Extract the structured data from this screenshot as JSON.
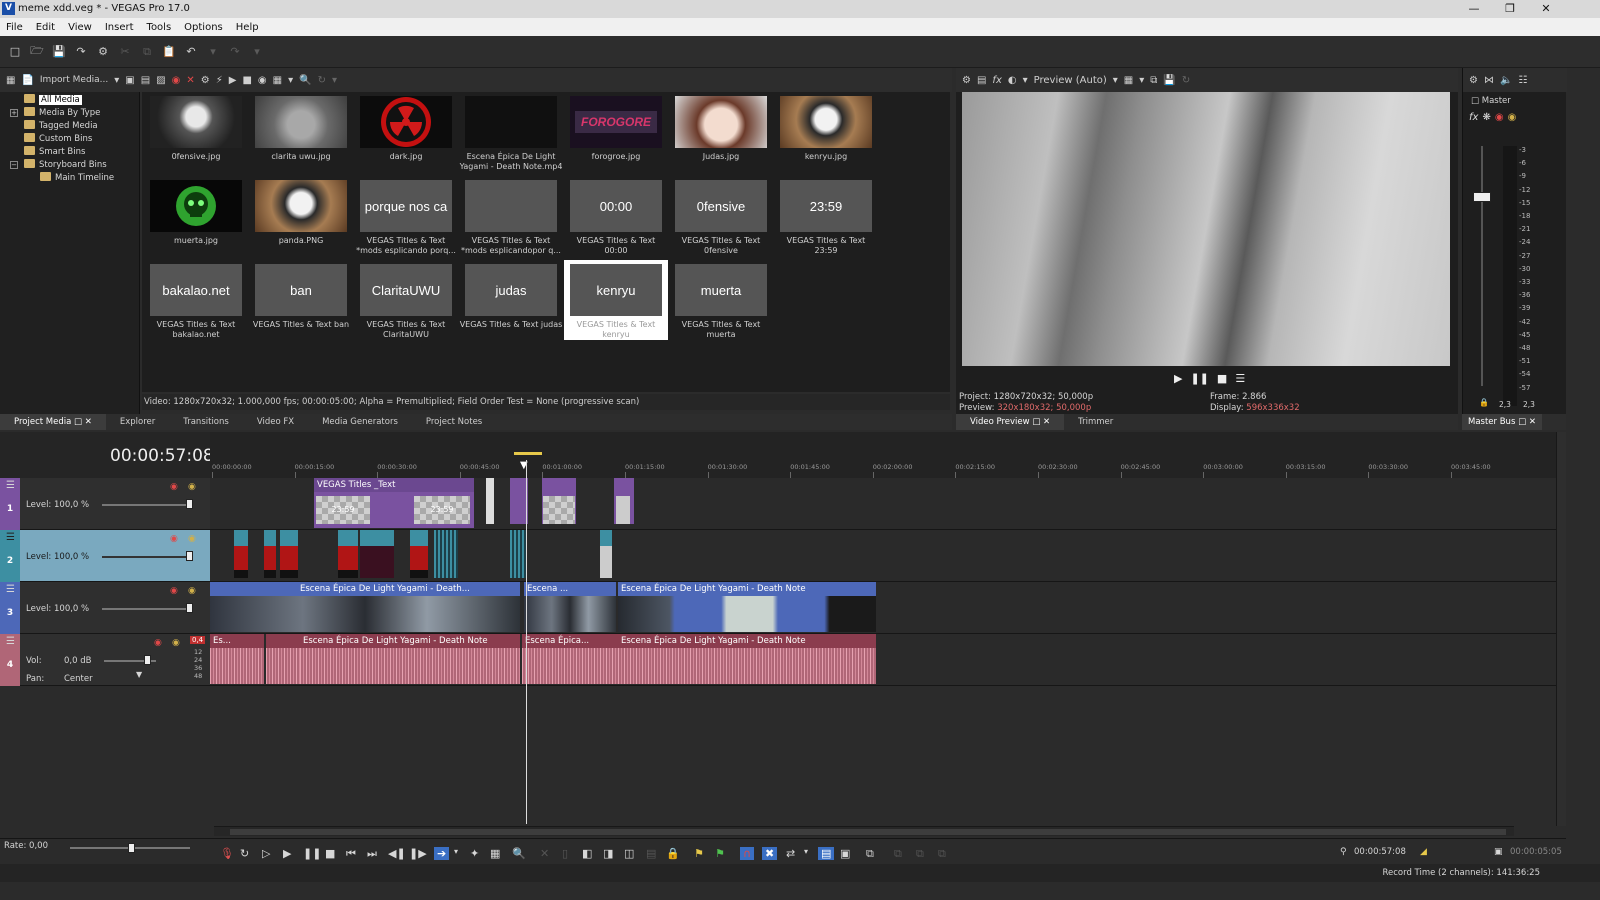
{
  "app": {
    "title": "meme xdd.veg * - VEGAS Pro 17.0",
    "icon_letter": "V"
  },
  "menu": [
    "File",
    "Edit",
    "View",
    "Insert",
    "Tools",
    "Options",
    "Help"
  ],
  "media_toolbar": {
    "import_label": "Import Media..."
  },
  "media_tree": [
    {
      "label": "All Media",
      "selected": true
    },
    {
      "label": "Media By Type"
    },
    {
      "label": "Tagged Media"
    },
    {
      "label": "Custom Bins"
    },
    {
      "label": "Smart Bins"
    },
    {
      "label": "Storyboard Bins"
    },
    {
      "label": "Main Timeline"
    }
  ],
  "media_items": [
    {
      "name": "0fensive.jpg",
      "thumb": "photo-girl"
    },
    {
      "name": "clarita uwu.jpg",
      "thumb": "photo-cat"
    },
    {
      "name": "dark.jpg",
      "thumb": "radiation"
    },
    {
      "name": "Escena Épica De Light Yagami - Death Note.mp4",
      "thumb": "black"
    },
    {
      "name": "forogroe.jpg",
      "thumb": "forogore",
      "thumb_text": "FOROGORE"
    },
    {
      "name": "Judas.jpg",
      "thumb": "anime"
    },
    {
      "name": "kenryu.jpg",
      "thumb": "panda"
    },
    {
      "name": "muerta.jpg",
      "thumb": "skull"
    },
    {
      "name": "panda.PNG",
      "thumb": "panda"
    },
    {
      "name": "VEGAS Titles & Text *mods esplicando porq...",
      "thumb": "title",
      "thumb_text": "porque nos ca"
    },
    {
      "name": "VEGAS Titles & Text *mods esplicandopor q...",
      "thumb": "title",
      "thumb_text": ""
    },
    {
      "name": "VEGAS Titles & Text 00:00",
      "thumb": "title",
      "thumb_text": "00:00"
    },
    {
      "name": "VEGAS Titles & Text 0fensive",
      "thumb": "title",
      "thumb_text": "0fensive"
    },
    {
      "name": "VEGAS Titles & Text 23:59",
      "thumb": "title",
      "thumb_text": "23:59"
    },
    {
      "name": "VEGAS Titles & Text bakalao.net",
      "thumb": "title",
      "thumb_text": "bakalao.net"
    },
    {
      "name": "VEGAS Titles & Text ban",
      "thumb": "title",
      "thumb_text": "ban"
    },
    {
      "name": "VEGAS Titles & Text ClaritaUWU",
      "thumb": "title",
      "thumb_text": "ClaritaUWU"
    },
    {
      "name": "VEGAS Titles & Text judas",
      "thumb": "title",
      "thumb_text": "judas"
    },
    {
      "name": "VEGAS Titles & Text kenryu",
      "thumb": "title",
      "thumb_text": "kenryu",
      "selected": true
    },
    {
      "name": "VEGAS Titles & Text muerta",
      "thumb": "title",
      "thumb_text": "muerta"
    }
  ],
  "media_info": "Video: 1280x720x32; 1.000,000 fps; 00:00:05:00; Alpha = Premultiplied; Field Order Test = None (progressive scan)",
  "left_tabs": [
    "Project Media",
    "Explorer",
    "Transitions",
    "Video FX",
    "Media Generators",
    "Project Notes"
  ],
  "preview": {
    "mode_label": "Preview (Auto)",
    "project_label": "Project:",
    "project_value": "1280x720x32; 50,000p",
    "preview_label": "Preview:",
    "preview_value": "320x180x32; 50,000p",
    "frame_label": "Frame:",
    "frame_value": "2.866",
    "display_label": "Display:",
    "display_value": "596x336x32",
    "tabs": [
      "Video Preview",
      "Trimmer"
    ]
  },
  "master_bus": {
    "label": "Master",
    "tab": "Master Bus",
    "scale": [
      "-3",
      "-6",
      "-9",
      "-12",
      "-15",
      "-18",
      "-21",
      "-24",
      "-27",
      "-30",
      "-33",
      "-36",
      "-39",
      "-42",
      "-45",
      "-48",
      "-51",
      "-54",
      "-57"
    ],
    "peak_left": "2,3",
    "peak_right": "2,3"
  },
  "timeline": {
    "timecode": "00:00:57:08",
    "ruler": [
      "00:00:00:00",
      "00:00:15:00",
      "00:00:30:00",
      "00:00:45:00",
      "00:01:00:00",
      "00:01:15:00",
      "00:01:30:00",
      "00:01:45:00",
      "00:02:00:00",
      "00:02:15:00",
      "00:02:30:00",
      "00:02:45:00",
      "00:03:00:00",
      "00:03:15:00",
      "00:03:30:00",
      "00:03:45:00"
    ],
    "tracks": [
      {
        "num": "1",
        "type": "video",
        "level_label": "Level: 100,0 %",
        "color": "#7a52a0"
      },
      {
        "num": "2",
        "type": "video",
        "level_label": "Level: 100,0 %",
        "color": "#3d8fa2"
      },
      {
        "num": "3",
        "type": "video",
        "level_label": "Level: 100,0 %",
        "color": "#4d68b8"
      },
      {
        "num": "4",
        "type": "audio",
        "vol_label": "Vol:",
        "vol_value": "0,0 dB",
        "pan_label": "Pan:",
        "pan_value": "Center",
        "peak": "0,4",
        "scale": [
          "12",
          "24",
          "36",
          "48"
        ],
        "color": "#b06677"
      }
    ],
    "clips": {
      "t1_title": "VEGAS Titles _Text",
      "t1_thumb": "23:59",
      "v3_a": "Escena Épica De Light Yagami - Death...",
      "v3_b": "Escena ...",
      "v3_c": "Escena Épica De Light Yagami - Death Note",
      "a4_a": "Es...",
      "a4_b": "Escena Épica De Light Yagami - Death Note",
      "a4_c": "Escena Épica...",
      "a4_d": "Escena Épica De Light Yagami - Death Note"
    }
  },
  "transport": {
    "rate_label": "Rate: 0,00",
    "cursor_time": "00:00:57:08",
    "selection_length": "00:00:05:05"
  },
  "status": {
    "record_time": "Record Time (2 channels): 141:36:25"
  },
  "colors": {
    "accent": "#4d68b8",
    "audio": "#b06677",
    "title_track": "#7a52a0",
    "meter_red": "#e04848"
  }
}
